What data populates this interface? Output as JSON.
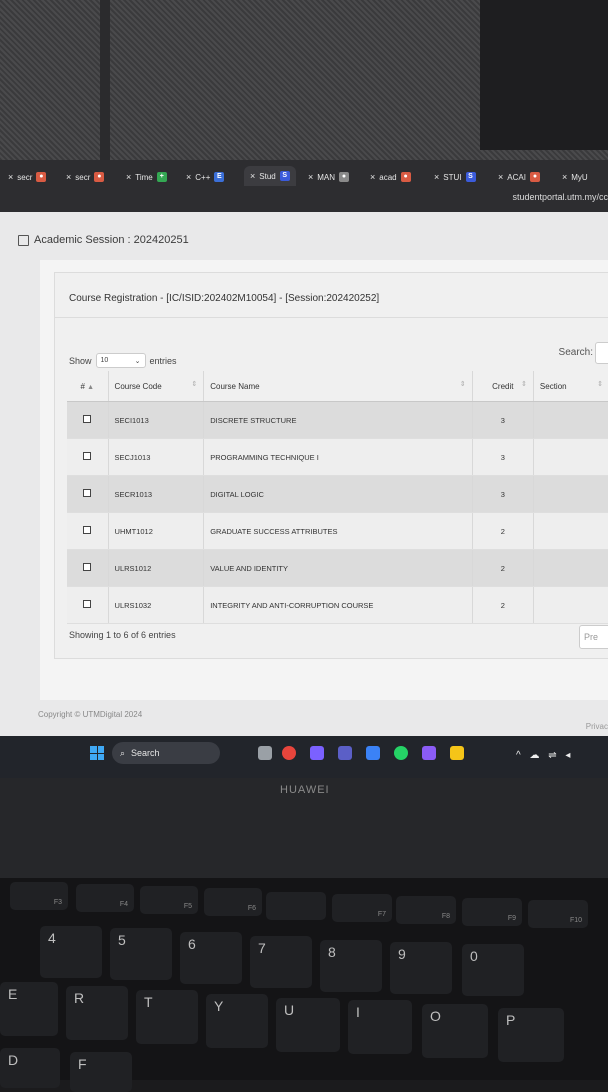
{
  "browser": {
    "tabs": [
      {
        "label": "secr",
        "fav": "#d95b43",
        "glyph": "●"
      },
      {
        "label": "secr",
        "fav": "#d95b43",
        "glyph": "●"
      },
      {
        "label": "Time",
        "fav": "#34a853",
        "glyph": "+"
      },
      {
        "label": "C++",
        "fav": "#3b6fd8",
        "glyph": "E"
      },
      {
        "label": "Stud",
        "fav": "#3b5bdb",
        "glyph": "S"
      },
      {
        "label": "MAN",
        "fav": "#8a8a8a",
        "glyph": "●"
      },
      {
        "label": "acad",
        "fav": "#d95b43",
        "glyph": "●"
      },
      {
        "label": "STUI",
        "fav": "#3b5bdb",
        "glyph": "S"
      },
      {
        "label": "ACAI",
        "fav": "#d95b43",
        "glyph": "●"
      },
      {
        "label": "MyU",
        "fav": "#8a8a8a",
        "glyph": ""
      }
    ],
    "url": "studentportal.utm.my/cc"
  },
  "header": {
    "session": "Academic Session : 202420251"
  },
  "card": {
    "title": "Course Registration - [IC/ISID:202402M10054] - [Session:202420252]"
  },
  "table_controls": {
    "show_label": "Show",
    "entries_value": "10",
    "entries_label": "entries",
    "search_label": "Search:"
  },
  "table": {
    "headers": {
      "num": "#",
      "code": "Course Code",
      "name": "Course Name",
      "credit": "Credit",
      "section": "Section"
    },
    "rows": [
      {
        "code": "SECI1013",
        "name": "DISCRETE STRUCTURE",
        "credit": "3",
        "section": ""
      },
      {
        "code": "SECJ1013",
        "name": "PROGRAMMING TECHNIQUE I",
        "credit": "3",
        "section": ""
      },
      {
        "code": "SECR1013",
        "name": "DIGITAL LOGIC",
        "credit": "3",
        "section": ""
      },
      {
        "code": "UHMT1012",
        "name": "GRADUATE SUCCESS ATTRIBUTES",
        "credit": "2",
        "section": ""
      },
      {
        "code": "ULRS1012",
        "name": "VALUE AND IDENTITY",
        "credit": "2",
        "section": ""
      },
      {
        "code": "ULRS1032",
        "name": "INTEGRITY AND ANTI-CORRUPTION COURSE",
        "credit": "2",
        "section": ""
      }
    ]
  },
  "pagination": {
    "info": "Showing 1 to 6 of 6 entries",
    "prev": "Pre"
  },
  "footer": {
    "copyright": "Copyright © UTMDigital 2024",
    "privacy": "Privac"
  },
  "taskbar": {
    "search": "Search"
  },
  "laptop": {
    "brand": "HUAWEI"
  },
  "keys": {
    "f3": "F3",
    "f4": "F4",
    "f5": "F5",
    "f6": "F6",
    "f7": "F7",
    "f8": "F8",
    "f9": "F9",
    "f10": "F10",
    "n4": "4",
    "n5": "5",
    "n6": "6",
    "n7": "7",
    "n8": "8",
    "n9": "9",
    "n0": "0",
    "e": "E",
    "r": "R",
    "t": "T",
    "y": "Y",
    "u": "U",
    "i": "I",
    "o": "O",
    "p": "P",
    "d": "D",
    "f": "F"
  }
}
